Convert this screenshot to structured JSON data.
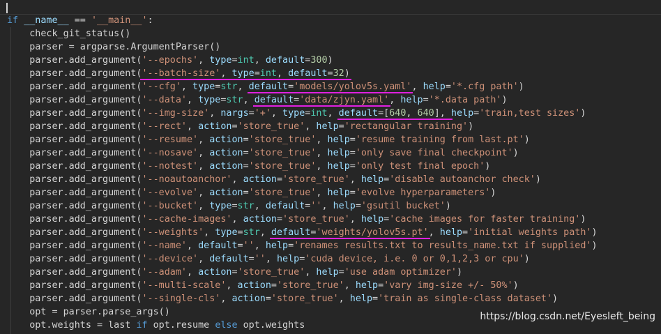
{
  "lines": [
    {
      "tokens": [
        {
          "t": "if ",
          "c": "kw"
        },
        {
          "t": "__name__",
          "c": "param"
        },
        {
          "t": " == ",
          "c": "op"
        },
        {
          "t": "'__main__'",
          "c": "str"
        },
        {
          "t": ":",
          "c": "op"
        }
      ]
    },
    {
      "tokens": [
        {
          "t": "    check_git_status()",
          "c": "op"
        }
      ]
    },
    {
      "tokens": [
        {
          "t": "    parser = argparse.ArgumentParser()",
          "c": "op"
        }
      ]
    },
    {
      "tokens": [
        {
          "t": "    parser.add_argument(",
          "c": "op"
        },
        {
          "t": "'--epochs'",
          "c": "str"
        },
        {
          "t": ", ",
          "c": "op"
        },
        {
          "t": "type",
          "c": "param"
        },
        {
          "t": "=",
          "c": "op"
        },
        {
          "t": "int",
          "c": "type"
        },
        {
          "t": ", ",
          "c": "op"
        },
        {
          "t": "default",
          "c": "param"
        },
        {
          "t": "=",
          "c": "op"
        },
        {
          "t": "300",
          "c": "num"
        },
        {
          "t": ")",
          "c": "op"
        }
      ]
    },
    {
      "tokens": [
        {
          "t": "    parser.add_argument(",
          "c": "op"
        },
        {
          "t": "'--batch-size'",
          "c": "str"
        },
        {
          "t": ", ",
          "c": "op"
        },
        {
          "t": "type",
          "c": "param"
        },
        {
          "t": "=",
          "c": "op"
        },
        {
          "t": "int",
          "c": "type"
        },
        {
          "t": ", ",
          "c": "op"
        },
        {
          "t": "default",
          "c": "param"
        },
        {
          "t": "=",
          "c": "op"
        },
        {
          "t": "32",
          "c": "num"
        },
        {
          "t": ")",
          "c": "op"
        }
      ]
    },
    {
      "tokens": [
        {
          "t": "    parser.add_argument(",
          "c": "op"
        },
        {
          "t": "'--cfg'",
          "c": "str"
        },
        {
          "t": ", ",
          "c": "op"
        },
        {
          "t": "type",
          "c": "param"
        },
        {
          "t": "=",
          "c": "op"
        },
        {
          "t": "str",
          "c": "type"
        },
        {
          "t": ", ",
          "c": "op"
        },
        {
          "t": "default",
          "c": "param"
        },
        {
          "t": "=",
          "c": "op"
        },
        {
          "t": "'models/yolov5s.yaml'",
          "c": "str"
        },
        {
          "t": ", ",
          "c": "op"
        },
        {
          "t": "help",
          "c": "param"
        },
        {
          "t": "=",
          "c": "op"
        },
        {
          "t": "'*.cfg path'",
          "c": "str"
        },
        {
          "t": ")",
          "c": "op"
        }
      ]
    },
    {
      "tokens": [
        {
          "t": "    parser.add_argument(",
          "c": "op"
        },
        {
          "t": "'--data'",
          "c": "str"
        },
        {
          "t": ", ",
          "c": "op"
        },
        {
          "t": "type",
          "c": "param"
        },
        {
          "t": "=",
          "c": "op"
        },
        {
          "t": "str",
          "c": "type"
        },
        {
          "t": ", ",
          "c": "op"
        },
        {
          "t": "default",
          "c": "param"
        },
        {
          "t": "=",
          "c": "op"
        },
        {
          "t": "'data/zjyn.yaml'",
          "c": "str"
        },
        {
          "t": ", ",
          "c": "op"
        },
        {
          "t": "help",
          "c": "param"
        },
        {
          "t": "=",
          "c": "op"
        },
        {
          "t": "'*.data path'",
          "c": "str"
        },
        {
          "t": ")",
          "c": "op"
        }
      ]
    },
    {
      "tokens": [
        {
          "t": "    parser.add_argument(",
          "c": "op"
        },
        {
          "t": "'--img-size'",
          "c": "str"
        },
        {
          "t": ", ",
          "c": "op"
        },
        {
          "t": "nargs",
          "c": "param"
        },
        {
          "t": "=",
          "c": "op"
        },
        {
          "t": "'+'",
          "c": "str"
        },
        {
          "t": ", ",
          "c": "op"
        },
        {
          "t": "type",
          "c": "param"
        },
        {
          "t": "=",
          "c": "op"
        },
        {
          "t": "int",
          "c": "type"
        },
        {
          "t": ", ",
          "c": "op"
        },
        {
          "t": "default",
          "c": "param"
        },
        {
          "t": "=[",
          "c": "op"
        },
        {
          "t": "640",
          "c": "num"
        },
        {
          "t": ", ",
          "c": "op"
        },
        {
          "t": "640",
          "c": "num"
        },
        {
          "t": "], ",
          "c": "op"
        },
        {
          "t": "help",
          "c": "param"
        },
        {
          "t": "=",
          "c": "op"
        },
        {
          "t": "'train,test sizes'",
          "c": "str"
        },
        {
          "t": ")",
          "c": "op"
        }
      ]
    },
    {
      "tokens": [
        {
          "t": "    parser.add_argument(",
          "c": "op"
        },
        {
          "t": "'--rect'",
          "c": "str"
        },
        {
          "t": ", ",
          "c": "op"
        },
        {
          "t": "action",
          "c": "param"
        },
        {
          "t": "=",
          "c": "op"
        },
        {
          "t": "'store_true'",
          "c": "str"
        },
        {
          "t": ", ",
          "c": "op"
        },
        {
          "t": "help",
          "c": "param"
        },
        {
          "t": "=",
          "c": "op"
        },
        {
          "t": "'rectangular training'",
          "c": "str"
        },
        {
          "t": ")",
          "c": "op"
        }
      ]
    },
    {
      "tokens": [
        {
          "t": "    parser.add_argument(",
          "c": "op"
        },
        {
          "t": "'--resume'",
          "c": "str"
        },
        {
          "t": ", ",
          "c": "op"
        },
        {
          "t": "action",
          "c": "param"
        },
        {
          "t": "=",
          "c": "op"
        },
        {
          "t": "'store_true'",
          "c": "str"
        },
        {
          "t": ", ",
          "c": "op"
        },
        {
          "t": "help",
          "c": "param"
        },
        {
          "t": "=",
          "c": "op"
        },
        {
          "t": "'resume training from last.pt'",
          "c": "str"
        },
        {
          "t": ")",
          "c": "op"
        }
      ]
    },
    {
      "tokens": [
        {
          "t": "    parser.add_argument(",
          "c": "op"
        },
        {
          "t": "'--nosave'",
          "c": "str"
        },
        {
          "t": ", ",
          "c": "op"
        },
        {
          "t": "action",
          "c": "param"
        },
        {
          "t": "=",
          "c": "op"
        },
        {
          "t": "'store_true'",
          "c": "str"
        },
        {
          "t": ", ",
          "c": "op"
        },
        {
          "t": "help",
          "c": "param"
        },
        {
          "t": "=",
          "c": "op"
        },
        {
          "t": "'only save final checkpoint'",
          "c": "str"
        },
        {
          "t": ")",
          "c": "op"
        }
      ]
    },
    {
      "tokens": [
        {
          "t": "    parser.add_argument(",
          "c": "op"
        },
        {
          "t": "'--notest'",
          "c": "str"
        },
        {
          "t": ", ",
          "c": "op"
        },
        {
          "t": "action",
          "c": "param"
        },
        {
          "t": "=",
          "c": "op"
        },
        {
          "t": "'store_true'",
          "c": "str"
        },
        {
          "t": ", ",
          "c": "op"
        },
        {
          "t": "help",
          "c": "param"
        },
        {
          "t": "=",
          "c": "op"
        },
        {
          "t": "'only test final epoch'",
          "c": "str"
        },
        {
          "t": ")",
          "c": "op"
        }
      ]
    },
    {
      "tokens": [
        {
          "t": "    parser.add_argument(",
          "c": "op"
        },
        {
          "t": "'--noautoanchor'",
          "c": "str"
        },
        {
          "t": ", ",
          "c": "op"
        },
        {
          "t": "action",
          "c": "param"
        },
        {
          "t": "=",
          "c": "op"
        },
        {
          "t": "'store_true'",
          "c": "str"
        },
        {
          "t": ", ",
          "c": "op"
        },
        {
          "t": "help",
          "c": "param"
        },
        {
          "t": "=",
          "c": "op"
        },
        {
          "t": "'disable autoanchor check'",
          "c": "str"
        },
        {
          "t": ")",
          "c": "op"
        }
      ]
    },
    {
      "tokens": [
        {
          "t": "    parser.add_argument(",
          "c": "op"
        },
        {
          "t": "'--evolve'",
          "c": "str"
        },
        {
          "t": ", ",
          "c": "op"
        },
        {
          "t": "action",
          "c": "param"
        },
        {
          "t": "=",
          "c": "op"
        },
        {
          "t": "'store_true'",
          "c": "str"
        },
        {
          "t": ", ",
          "c": "op"
        },
        {
          "t": "help",
          "c": "param"
        },
        {
          "t": "=",
          "c": "op"
        },
        {
          "t": "'evolve hyperparameters'",
          "c": "str"
        },
        {
          "t": ")",
          "c": "op"
        }
      ]
    },
    {
      "tokens": [
        {
          "t": "    parser.add_argument(",
          "c": "op"
        },
        {
          "t": "'--bucket'",
          "c": "str"
        },
        {
          "t": ", ",
          "c": "op"
        },
        {
          "t": "type",
          "c": "param"
        },
        {
          "t": "=",
          "c": "op"
        },
        {
          "t": "str",
          "c": "type"
        },
        {
          "t": ", ",
          "c": "op"
        },
        {
          "t": "default",
          "c": "param"
        },
        {
          "t": "=",
          "c": "op"
        },
        {
          "t": "''",
          "c": "str"
        },
        {
          "t": ", ",
          "c": "op"
        },
        {
          "t": "help",
          "c": "param"
        },
        {
          "t": "=",
          "c": "op"
        },
        {
          "t": "'gsutil bucket'",
          "c": "str"
        },
        {
          "t": ")",
          "c": "op"
        }
      ]
    },
    {
      "tokens": [
        {
          "t": "    parser.add_argument(",
          "c": "op"
        },
        {
          "t": "'--cache-images'",
          "c": "str"
        },
        {
          "t": ", ",
          "c": "op"
        },
        {
          "t": "action",
          "c": "param"
        },
        {
          "t": "=",
          "c": "op"
        },
        {
          "t": "'store_true'",
          "c": "str"
        },
        {
          "t": ", ",
          "c": "op"
        },
        {
          "t": "help",
          "c": "param"
        },
        {
          "t": "=",
          "c": "op"
        },
        {
          "t": "'cache images for faster training'",
          "c": "str"
        },
        {
          "t": ")",
          "c": "op"
        }
      ]
    },
    {
      "tokens": [
        {
          "t": "    parser.add_argument(",
          "c": "op"
        },
        {
          "t": "'--weights'",
          "c": "str"
        },
        {
          "t": ", ",
          "c": "op"
        },
        {
          "t": "type",
          "c": "param"
        },
        {
          "t": "=",
          "c": "op"
        },
        {
          "t": "str",
          "c": "type"
        },
        {
          "t": ", ",
          "c": "op"
        },
        {
          "t": "default",
          "c": "param"
        },
        {
          "t": "=",
          "c": "op"
        },
        {
          "t": "'weights/yolov5s.pt'",
          "c": "str"
        },
        {
          "t": ", ",
          "c": "op"
        },
        {
          "t": "help",
          "c": "param"
        },
        {
          "t": "=",
          "c": "op"
        },
        {
          "t": "'initial weights path'",
          "c": "str"
        },
        {
          "t": ")",
          "c": "op"
        }
      ]
    },
    {
      "tokens": [
        {
          "t": "    parser.add_argument(",
          "c": "op"
        },
        {
          "t": "'--name'",
          "c": "str"
        },
        {
          "t": ", ",
          "c": "op"
        },
        {
          "t": "default",
          "c": "param"
        },
        {
          "t": "=",
          "c": "op"
        },
        {
          "t": "''",
          "c": "str"
        },
        {
          "t": ", ",
          "c": "op"
        },
        {
          "t": "help",
          "c": "param"
        },
        {
          "t": "=",
          "c": "op"
        },
        {
          "t": "'renames results.txt to results_name.txt if supplied'",
          "c": "str"
        },
        {
          "t": ")",
          "c": "op"
        }
      ]
    },
    {
      "tokens": [
        {
          "t": "    parser.add_argument(",
          "c": "op"
        },
        {
          "t": "'--device'",
          "c": "str"
        },
        {
          "t": ", ",
          "c": "op"
        },
        {
          "t": "default",
          "c": "param"
        },
        {
          "t": "=",
          "c": "op"
        },
        {
          "t": "''",
          "c": "str"
        },
        {
          "t": ", ",
          "c": "op"
        },
        {
          "t": "help",
          "c": "param"
        },
        {
          "t": "=",
          "c": "op"
        },
        {
          "t": "'cuda device, i.e. 0 or 0,1,2,3 or cpu'",
          "c": "str"
        },
        {
          "t": ")",
          "c": "op"
        }
      ]
    },
    {
      "tokens": [
        {
          "t": "    parser.add_argument(",
          "c": "op"
        },
        {
          "t": "'--adam'",
          "c": "str"
        },
        {
          "t": ", ",
          "c": "op"
        },
        {
          "t": "action",
          "c": "param"
        },
        {
          "t": "=",
          "c": "op"
        },
        {
          "t": "'store_true'",
          "c": "str"
        },
        {
          "t": ", ",
          "c": "op"
        },
        {
          "t": "help",
          "c": "param"
        },
        {
          "t": "=",
          "c": "op"
        },
        {
          "t": "'use adam optimizer'",
          "c": "str"
        },
        {
          "t": ")",
          "c": "op"
        }
      ]
    },
    {
      "tokens": [
        {
          "t": "    parser.add_argument(",
          "c": "op"
        },
        {
          "t": "'--multi-scale'",
          "c": "str"
        },
        {
          "t": ", ",
          "c": "op"
        },
        {
          "t": "action",
          "c": "param"
        },
        {
          "t": "=",
          "c": "op"
        },
        {
          "t": "'store_true'",
          "c": "str"
        },
        {
          "t": ", ",
          "c": "op"
        },
        {
          "t": "help",
          "c": "param"
        },
        {
          "t": "=",
          "c": "op"
        },
        {
          "t": "'vary img-size +/- 50%'",
          "c": "str"
        },
        {
          "t": ")",
          "c": "op"
        }
      ]
    },
    {
      "tokens": [
        {
          "t": "    parser.add_argument(",
          "c": "op"
        },
        {
          "t": "'--single-cls'",
          "c": "str"
        },
        {
          "t": ", ",
          "c": "op"
        },
        {
          "t": "action",
          "c": "param"
        },
        {
          "t": "=",
          "c": "op"
        },
        {
          "t": "'store_true'",
          "c": "str"
        },
        {
          "t": ", ",
          "c": "op"
        },
        {
          "t": "help",
          "c": "param"
        },
        {
          "t": "=",
          "c": "op"
        },
        {
          "t": "'train as single-class dataset'",
          "c": "str"
        },
        {
          "t": ")",
          "c": "op"
        }
      ]
    },
    {
      "tokens": [
        {
          "t": "    opt = parser.parse_args()",
          "c": "op"
        }
      ]
    },
    {
      "tokens": [
        {
          "t": "    opt.weights = last ",
          "c": "op"
        },
        {
          "t": "if",
          "c": "kw"
        },
        {
          "t": " opt.resume ",
          "c": "op"
        },
        {
          "t": "else",
          "c": "kw"
        },
        {
          "t": " opt.weights",
          "c": "op"
        }
      ]
    }
  ],
  "highlights": [
    {
      "line": 4,
      "from": "'--batch-size'",
      "to": ")"
    },
    {
      "line": 5,
      "from": "default",
      "to": "'models/yolov5s.yaml'"
    },
    {
      "line": 6,
      "from": "default",
      "to": "'data/zjyn.yaml'"
    },
    {
      "line": 7,
      "from": "default",
      "to": "]"
    },
    {
      "line": 16,
      "from": "default",
      "to": "'weights/yolov5s.pt'"
    }
  ],
  "watermark": "https://blog.csdn.net/Eyesleft_being",
  "colors": {
    "highlight": "#e020e0",
    "background": "#262626"
  }
}
